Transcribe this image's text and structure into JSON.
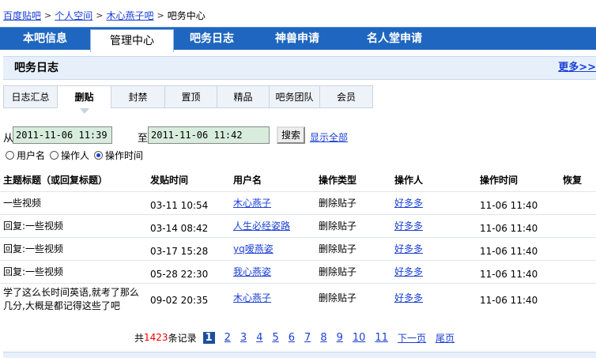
{
  "breadcrumb": {
    "items": [
      "百度贴吧",
      "个人空间",
      "木心燕子吧"
    ],
    "current": "吧务中心",
    "sep": ">"
  },
  "mainnav": {
    "tabs": [
      "本吧信息",
      "管理中心",
      "吧务日志",
      "神兽申请",
      "名人堂申请"
    ],
    "active": "管理中心"
  },
  "panel": {
    "title": "吧务日志",
    "more": "更多>>"
  },
  "subtabs": {
    "items": [
      "日志汇总",
      "删贴",
      "封禁",
      "置顶",
      "精品",
      "吧务团队",
      "会员"
    ],
    "active": "删贴"
  },
  "filter": {
    "from_label": "从",
    "from_value": "2011-11-06 11:39",
    "to_label": "至",
    "to_value": "2011-11-06 11:42",
    "search_label": "搜索",
    "show_all": "显示全部"
  },
  "radios": [
    {
      "label": "用户名",
      "checked": false
    },
    {
      "label": "操作人",
      "checked": false
    },
    {
      "label": "操作时间",
      "checked": true
    }
  ],
  "table": {
    "headers": [
      "主题标题（或回复标题）",
      "发贴时间",
      "用户名",
      "操作类型",
      "操作人",
      "操作时间",
      "恢复"
    ],
    "rows": [
      {
        "title": "一些视频",
        "post_time": "03-11 10:54",
        "user": "木心燕子",
        "type": "删除贴子",
        "operator": "好多多",
        "op_time": "11-06 11:40"
      },
      {
        "title": "回复:一些视频",
        "post_time": "03-14 08:42",
        "user": "人生必经姿路",
        "type": "删除贴子",
        "operator": "好多多",
        "op_time": "11-06 11:40"
      },
      {
        "title": "回复:一些视频",
        "post_time": "03-17 15:28",
        "user": "yq嗳燕姿",
        "type": "删除贴子",
        "operator": "好多多",
        "op_time": "11-06 11:40"
      },
      {
        "title": "回复:一些视频",
        "post_time": "05-28 22:30",
        "user": "我心燕姿",
        "type": "删除贴子",
        "operator": "好多多",
        "op_time": "11-06 11:40"
      },
      {
        "title": "学了这么长时间英语,就考了那么几分,大概是都记得这些了吧",
        "post_time": "09-02 20:35",
        "user": "木心燕子",
        "type": "删除贴子",
        "operator": "好多多",
        "op_time": "11-06 11:40"
      }
    ]
  },
  "pager": {
    "prefix": "共",
    "count": "1423",
    "suffix": "条记录",
    "pages": [
      "1",
      "2",
      "3",
      "4",
      "5",
      "6",
      "7",
      "8",
      "9",
      "10",
      "11"
    ],
    "current": "1",
    "next": "下一页",
    "last": "尾页"
  },
  "colors": {
    "nav_bg": "#1e66c0",
    "panel_bg": "#e7f0fa",
    "link": "#1a3fd6",
    "count": "#e00000"
  }
}
